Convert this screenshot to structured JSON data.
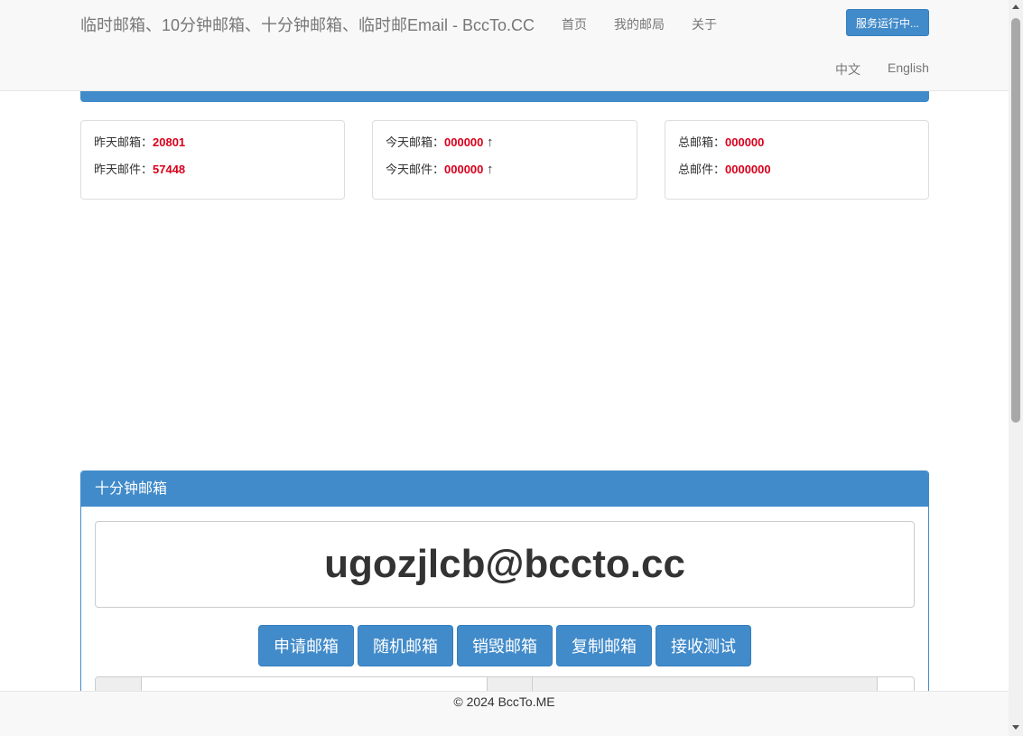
{
  "navbar": {
    "brand": "临时邮箱、10分钟邮箱、十分钟邮箱、临时邮Email - BccTo.CC",
    "links": [
      "首页",
      "我的邮局",
      "关于"
    ],
    "status_button": "服务运行中...",
    "languages": [
      "中文",
      "English"
    ]
  },
  "stats": {
    "yesterday": {
      "mailbox_label": "昨天邮箱：",
      "mailbox_value": "20801",
      "mail_label": "昨天邮件：",
      "mail_value": "57448"
    },
    "today": {
      "mailbox_label": "今天邮箱：",
      "mailbox_value": "000000",
      "mail_label": "今天邮件：",
      "mail_value": "000000",
      "arrow": "↑"
    },
    "total": {
      "mailbox_label": "总邮箱：",
      "mailbox_value": "000000",
      "mail_label": "总邮件：",
      "mail_value": "0000000"
    }
  },
  "panel": {
    "title": "十分钟邮箱",
    "email": "ugozjlcb@bccto.cc",
    "buttons": [
      "申请邮箱",
      "随机邮箱",
      "销毁邮箱",
      "复制邮箱",
      "接收测试"
    ]
  },
  "footer": {
    "copyright": "© 2024 BccTo.ME"
  },
  "colors": {
    "primary": "#428bca",
    "highlight": "#d9001b"
  }
}
